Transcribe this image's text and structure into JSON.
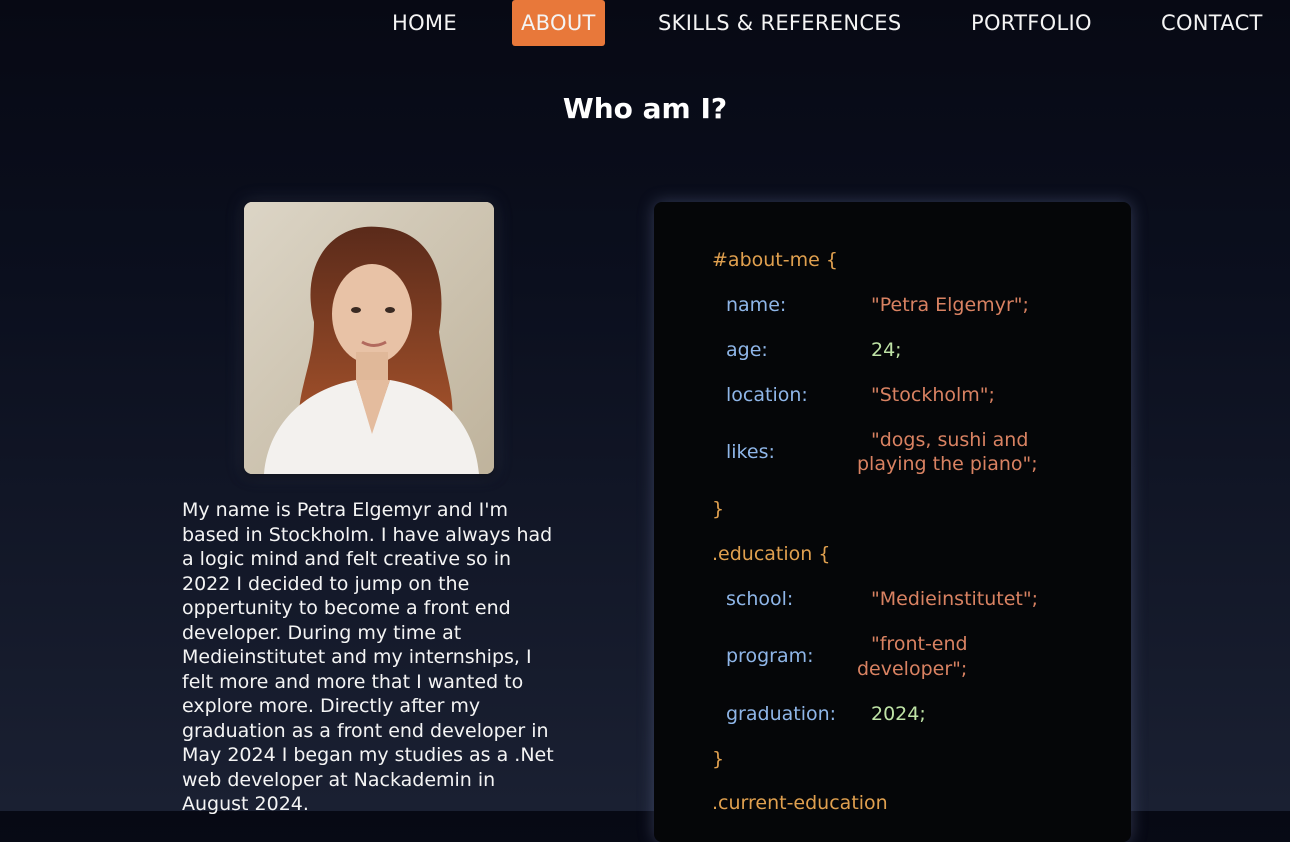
{
  "nav": {
    "items": [
      {
        "label": "HOME",
        "active": false
      },
      {
        "label": "ABOUT",
        "active": true
      },
      {
        "label": "SKILLS & REFERENCES",
        "active": false
      },
      {
        "label": "PORTFOLIO",
        "active": false
      },
      {
        "label": "CONTACT",
        "active": false
      }
    ]
  },
  "page": {
    "title": "Who am I?"
  },
  "bio": "My name is Petra Elgemyr and I'm based in Stockholm. I have always had a logic mind and felt creative so in 2022 I decided to jump on the oppertunity to become a front end developer. During my time at Medieinstitutet and my internships, I felt more and more that I wanted to explore more. Directly after my graduation as a front end developer in May 2024 I began my studies as a .Net web developer at Nackademin in August 2024.",
  "code": {
    "about_selector": "#about-me {",
    "name_prop": "name:",
    "name_val": "\"Petra Elgemyr\";",
    "age_prop": "age:",
    "age_val": "24;",
    "location_prop": "location:",
    "location_val": "\"Stockholm\";",
    "likes_prop": "likes:",
    "likes_val_1": "\"dogs, sushi and",
    "likes_val_2": "playing the piano\";",
    "close_1": "}",
    "education_selector": ".education {",
    "school_prop": "school:",
    "school_val": "\"Medieinstitutet\";",
    "program_prop": "program:",
    "program_val_1": "\"front-end",
    "program_val_2": "developer\";",
    "graduation_prop": "graduation:",
    "graduation_val": "2024;",
    "close_2": "}",
    "current_selector": ".current-education"
  },
  "colors": {
    "accent": "#e8783a",
    "selector": "#e0a04f",
    "property": "#8fb6e8",
    "string": "#d98262",
    "number": "#bfe3a6"
  }
}
